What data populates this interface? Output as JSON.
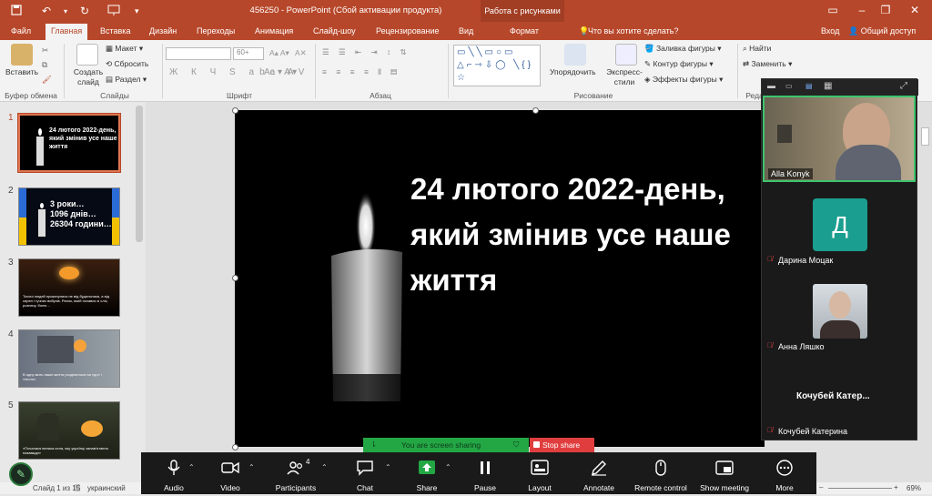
{
  "titlebar": {
    "title": "456250  -  PowerPoint (Сбой активации продукта)",
    "context_tab": "Работа с рисунками"
  },
  "tabs": [
    "Файл",
    "Главная",
    "Вставка",
    "Дизайн",
    "Переходы",
    "Анимация",
    "Слайд-шоу",
    "Рецензирование",
    "Вид",
    "Формат"
  ],
  "tab_search": "Что вы хотите сделать?",
  "login": "Вход",
  "share": "Общий доступ",
  "ribbon": {
    "paste": "Вставить",
    "clipboard": "Буфер обмена",
    "new_slide": "Создать слайд",
    "layout": "Макет",
    "reset": "Сбросить",
    "section": "Раздел",
    "slides": "Слайды",
    "font": "Шрифт",
    "font_size": "60+",
    "paragraph": "Абзац",
    "arrange": "Упорядочить",
    "quick_styles": "Экспресс-стили",
    "shape_fill": "Заливка фигуры",
    "shape_outline": "Контур фигуры",
    "shape_effects": "Эффекты фигуры",
    "drawing": "Рисование",
    "find": "Найти",
    "replace": "Заменить",
    "editing": "Реда"
  },
  "thumbnails": [
    {
      "num": "1",
      "text": "24 лютого 2022-день,\nякий змінив усе наше\nжиття"
    },
    {
      "num": "2",
      "text": "3 роки…\n1096 днів…\n26304 години…"
    },
    {
      "num": "3",
      "text": "Тисячі людей прокинулися не від будильника, а від сирен і гучних вибухів. Ранок, який почався зі сліз, розпачу, болю…"
    },
    {
      "num": "4",
      "text": "В одну мить наше життя розділилося на «до» і «після»."
    },
    {
      "num": "5",
      "text": "«Почалася велика сила, яку українці запам'ятають назавжди»"
    }
  ],
  "slide": {
    "title": "24 лютого 2022-день,\nякий змінив усе наше\nжиття"
  },
  "status": {
    "slide_of": "Слайд 1 из 15",
    "language": "украинский",
    "zoom": "69%"
  },
  "zoom_panel": {
    "participants": [
      {
        "name": "Alla Konyk",
        "type": "video"
      },
      {
        "name": "Дарина Моцак",
        "initial": "Д",
        "type": "avatar"
      },
      {
        "name": "Анна Ляшко",
        "type": "photo"
      },
      {
        "name": "Кочубей  Катер...",
        "type": "nameonly"
      },
      {
        "name": "Кочубей Катерина",
        "type": "label"
      }
    ]
  },
  "share_banner": {
    "text": "You are screen sharing",
    "stop": "Stop share"
  },
  "zoom_toolbar": {
    "buttons": [
      "Audio",
      "Video",
      "Participants",
      "Chat",
      "Share",
      "Pause",
      "Layout",
      "Annotate",
      "Remote control",
      "Show meeting",
      "More"
    ],
    "participants_count": "4"
  },
  "colors": {
    "ppt_accent": "#b7472a",
    "zoom_bg": "#1a1a1a",
    "share_green": "#23a744",
    "stop_red": "#e03e3e",
    "avatar_teal": "#1a9e8f"
  }
}
